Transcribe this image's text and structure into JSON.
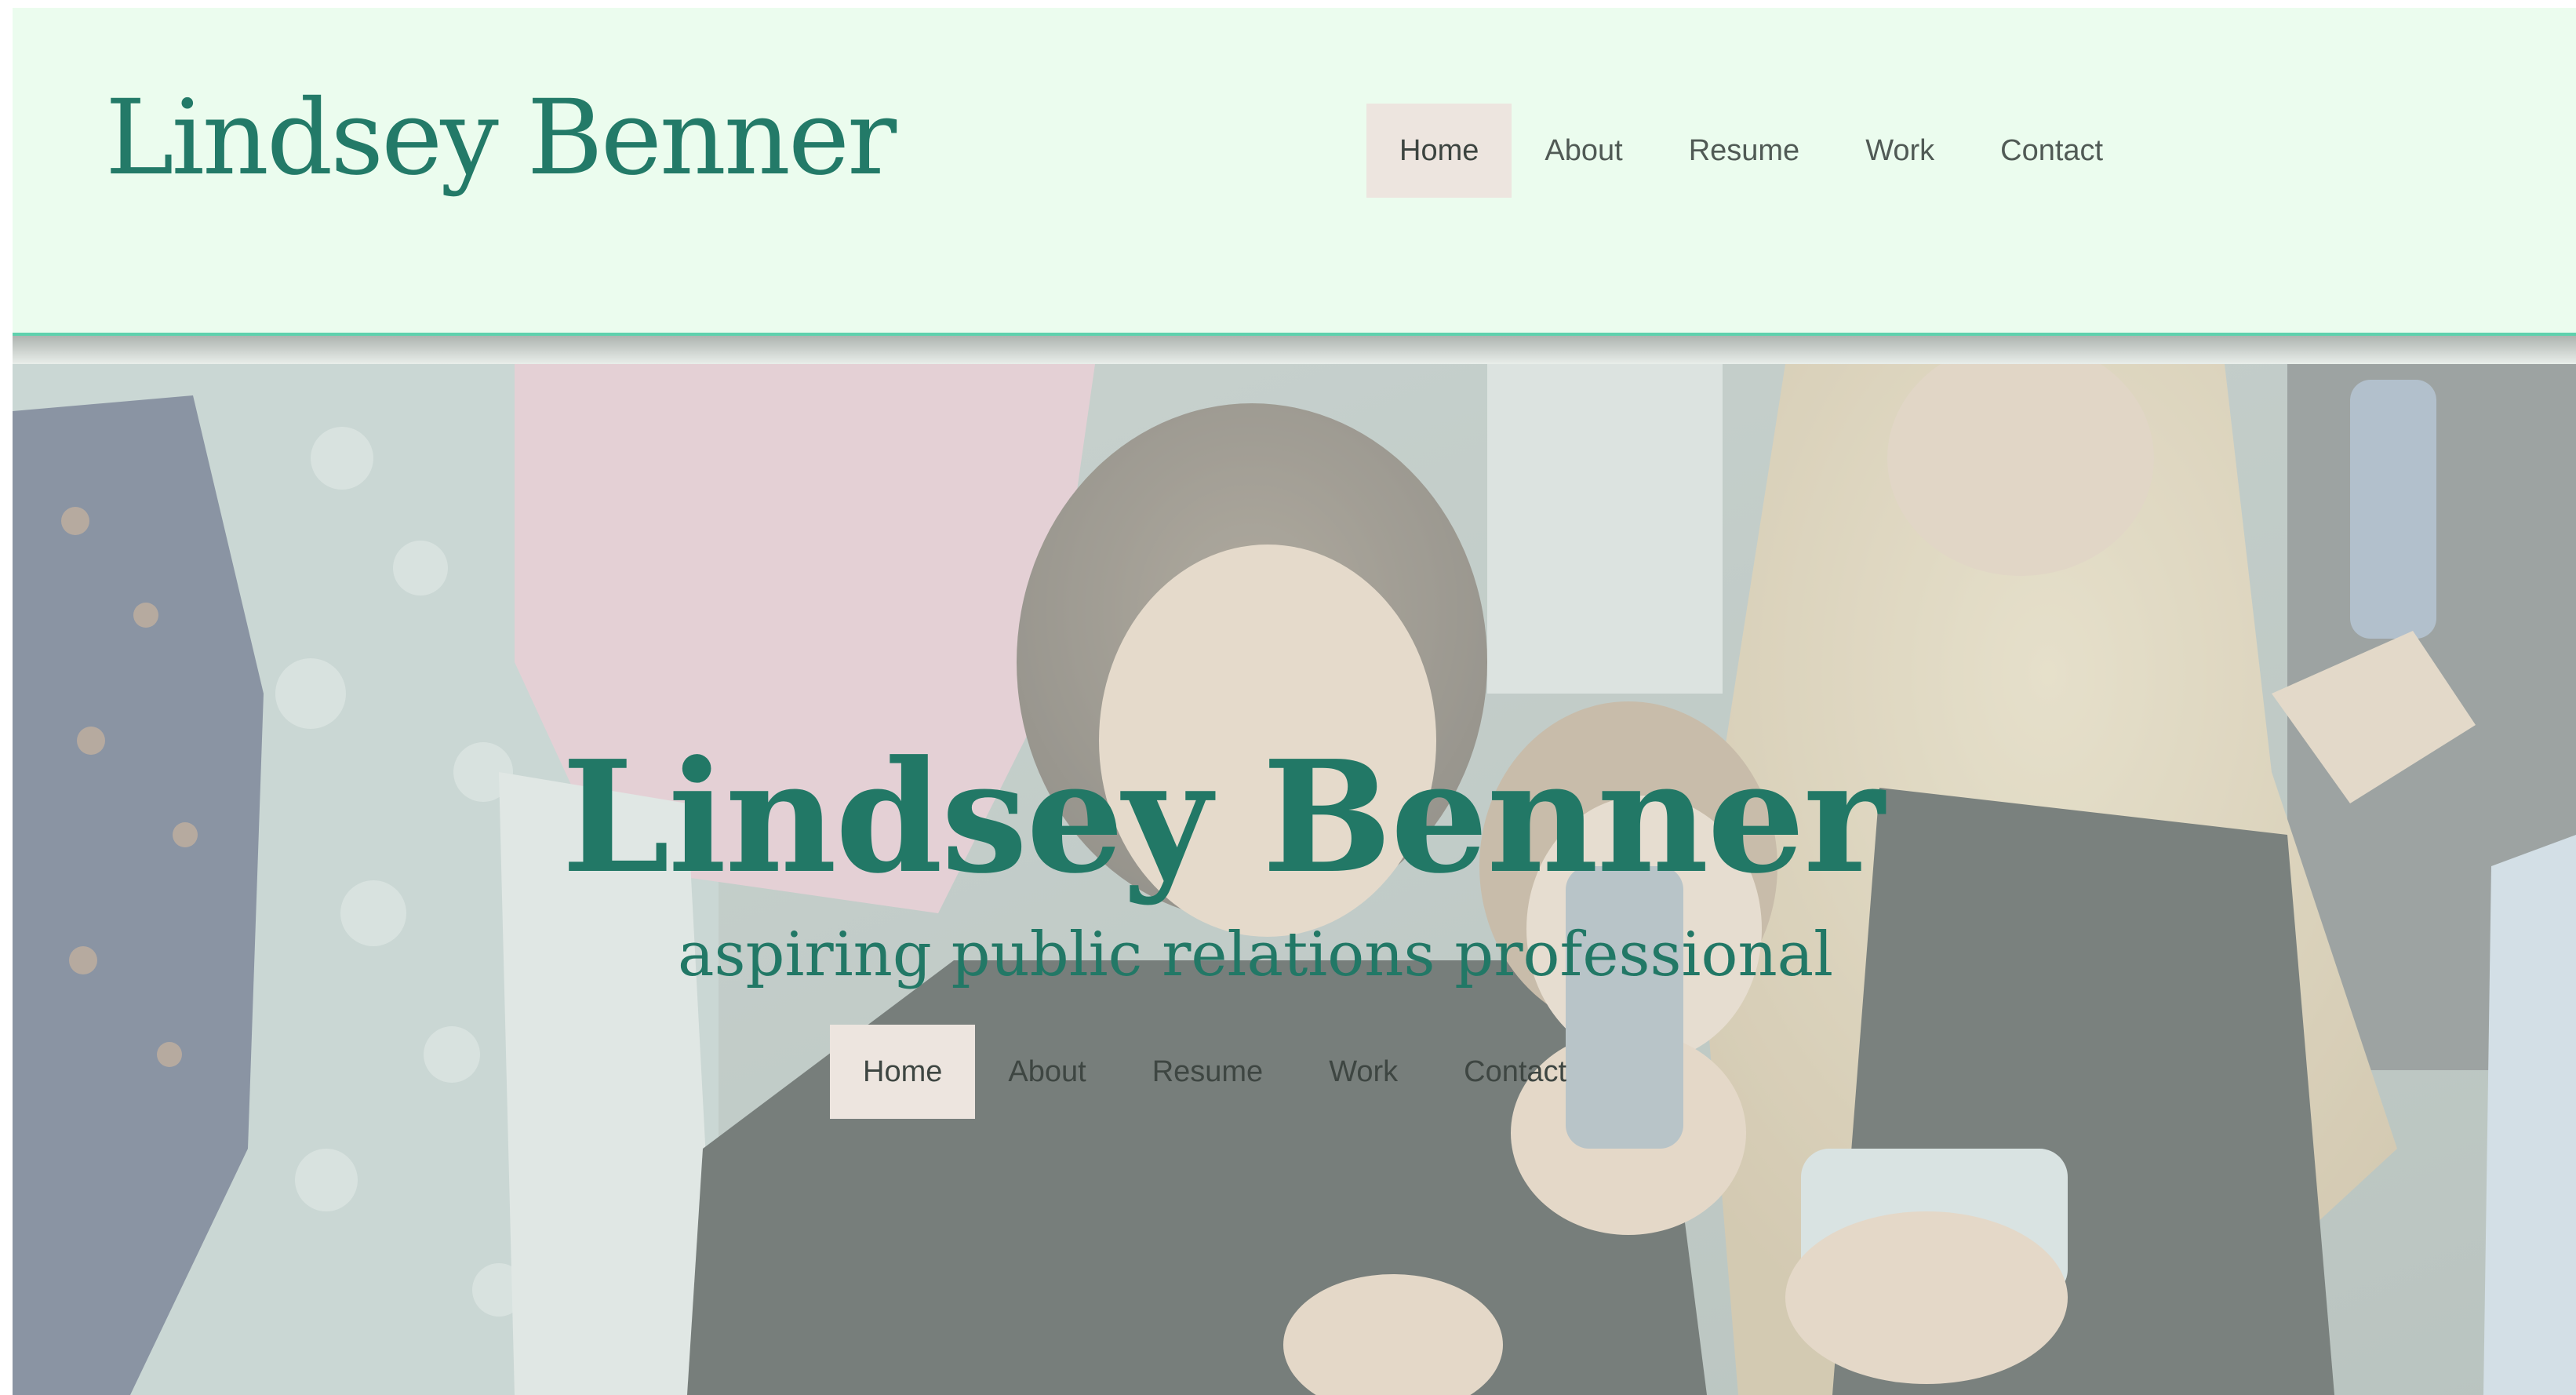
{
  "header": {
    "logo": "Lindsey Benner",
    "nav": [
      {
        "label": "Home",
        "active": true
      },
      {
        "label": "About",
        "active": false
      },
      {
        "label": "Resume",
        "active": false
      },
      {
        "label": "Work",
        "active": false
      },
      {
        "label": "Contact",
        "active": false
      }
    ]
  },
  "hero": {
    "title": "Lindsey Benner",
    "subtitle": "aspiring public relations professional",
    "nav": [
      {
        "label": "Home",
        "active": true
      },
      {
        "label": "About",
        "active": false
      },
      {
        "label": "Resume",
        "active": false
      },
      {
        "label": "Work",
        "active": false
      },
      {
        "label": "Contact",
        "active": false
      }
    ]
  },
  "colors": {
    "header_bg": "#ebfcee",
    "brand_green": "#237a68",
    "accent_rule": "#5fd1ad",
    "active_nav_bg": "#ede5df"
  }
}
